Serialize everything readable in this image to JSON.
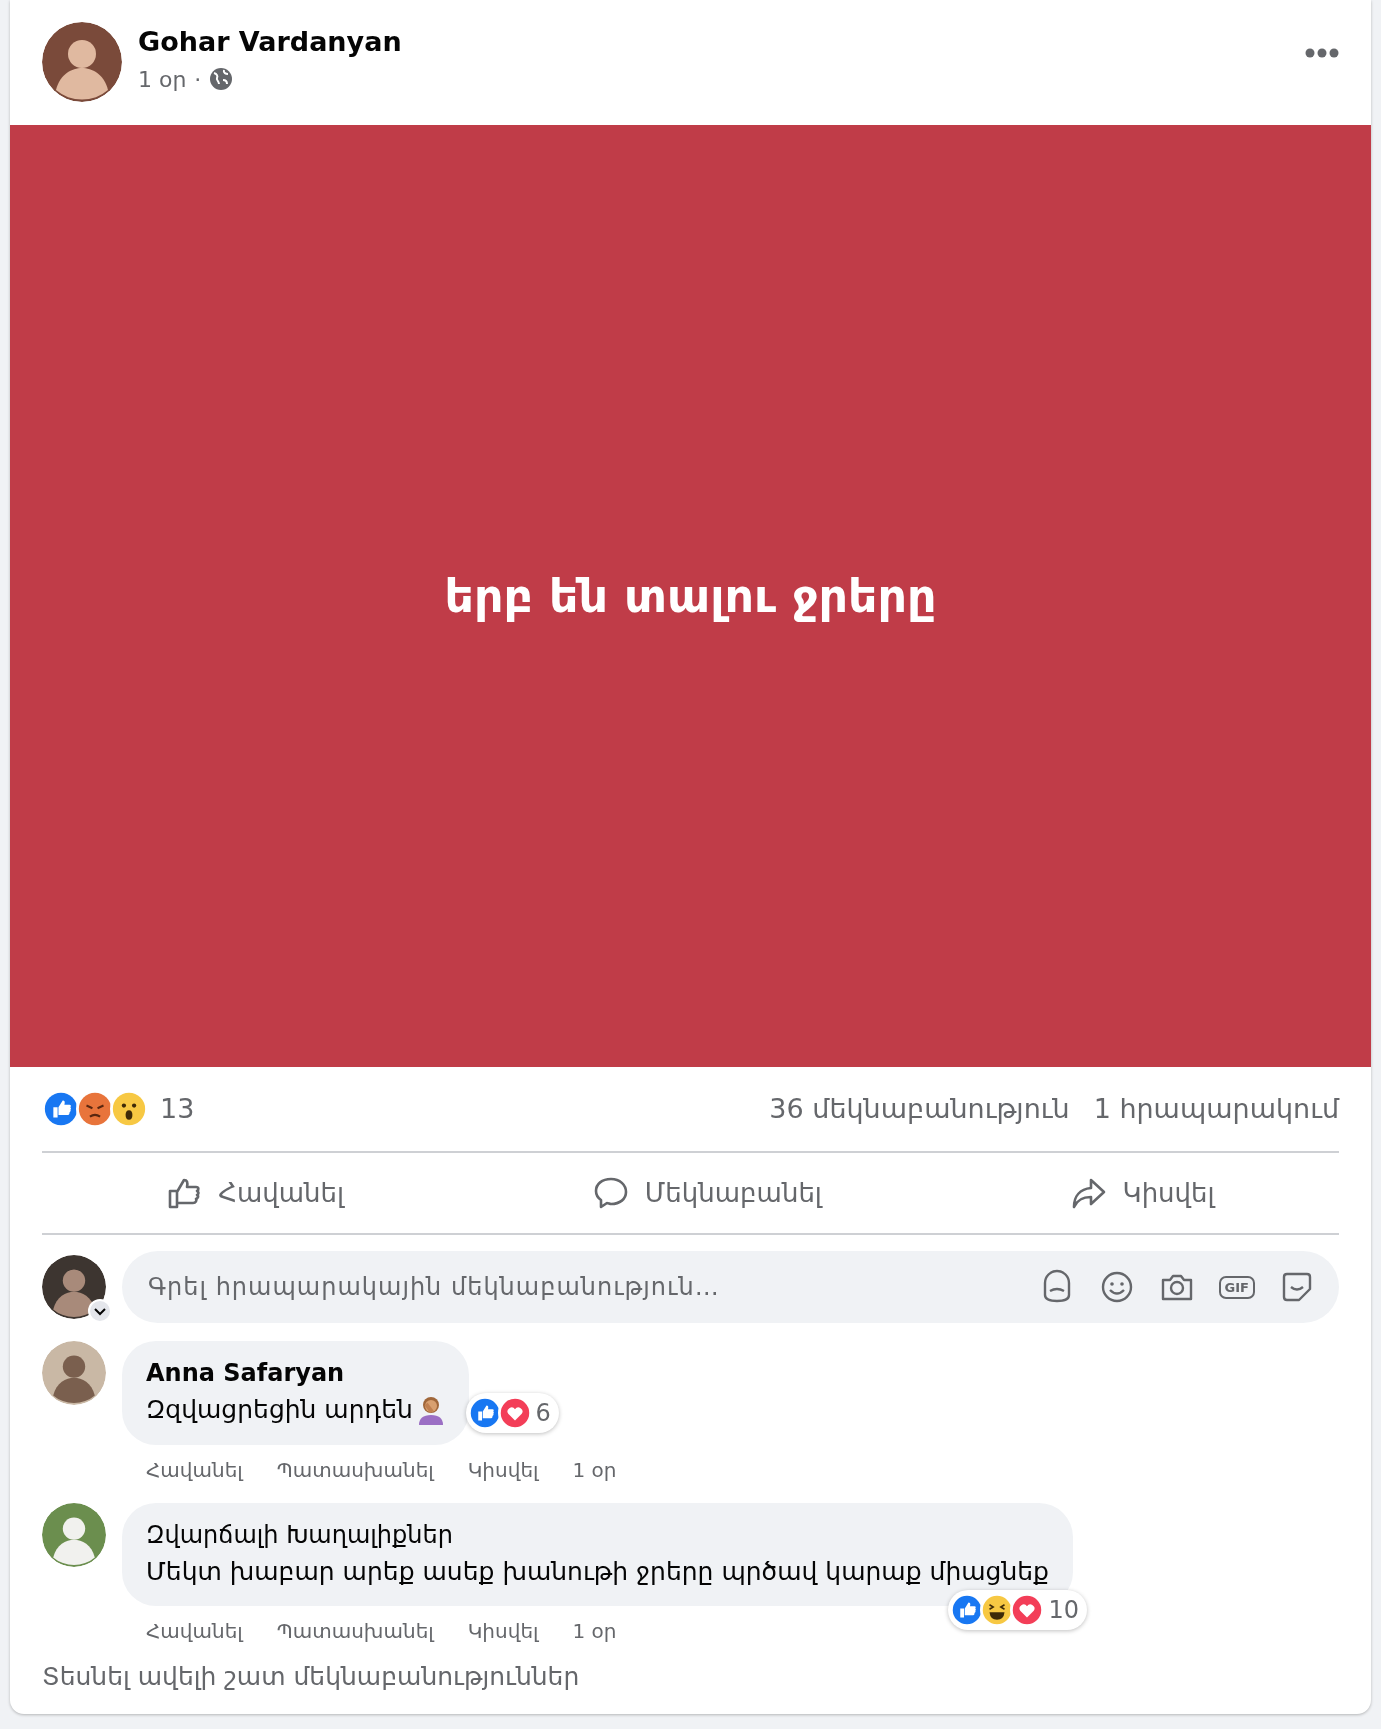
{
  "post": {
    "author": "Gohar Vardanyan",
    "time": "1 օր",
    "separator": "·",
    "text": "երբ են տալու ջրերը"
  },
  "stats": {
    "reactions": [
      {
        "kind": "like"
      },
      {
        "kind": "angry"
      },
      {
        "kind": "wow"
      }
    ],
    "reaction_count": "13",
    "comments": "36 մեկնաբանություն",
    "shares": "1 հրապարակում"
  },
  "actions": [
    {
      "kind": "like",
      "label": "Հավանել"
    },
    {
      "kind": "comment",
      "label": "Մեկնաբանել"
    },
    {
      "kind": "share",
      "label": "Կիսվել"
    }
  ],
  "composer": {
    "placeholder": "Գրել հրապարակային մեկնաբանություն…",
    "tools": [
      {
        "kind": "avatar"
      },
      {
        "kind": "emoji"
      },
      {
        "kind": "camera"
      },
      {
        "kind": "gif",
        "label": "GIF"
      },
      {
        "kind": "sticker"
      }
    ]
  },
  "comments": [
    {
      "author": "Anna Safaryan",
      "author_bold": true,
      "text": "Զզվացրեցին արդեն",
      "emoji": true,
      "reactions": [
        {
          "kind": "like"
        },
        {
          "kind": "love"
        }
      ],
      "reaction_count": "6",
      "actions": [
        "Հավանել",
        "Պատասխանել",
        "Կիսվել",
        "1 օր"
      ]
    },
    {
      "author": "Զվարճալի Խաղալիքներ",
      "author_bold": false,
      "text": "Մեկտ խաբար արեք ասեք խանութի ջրերը պրծավ կարաք միացնեք",
      "emoji": false,
      "reactions": [
        {
          "kind": "like"
        },
        {
          "kind": "haha"
        },
        {
          "kind": "love"
        }
      ],
      "reaction_count": "10",
      "actions": [
        "Հավանել",
        "Պատասխանել",
        "Կիսվել",
        "1 օր"
      ]
    }
  ],
  "more_comments": "Տեսնել ավելի շատ մեկնաբանություններ"
}
